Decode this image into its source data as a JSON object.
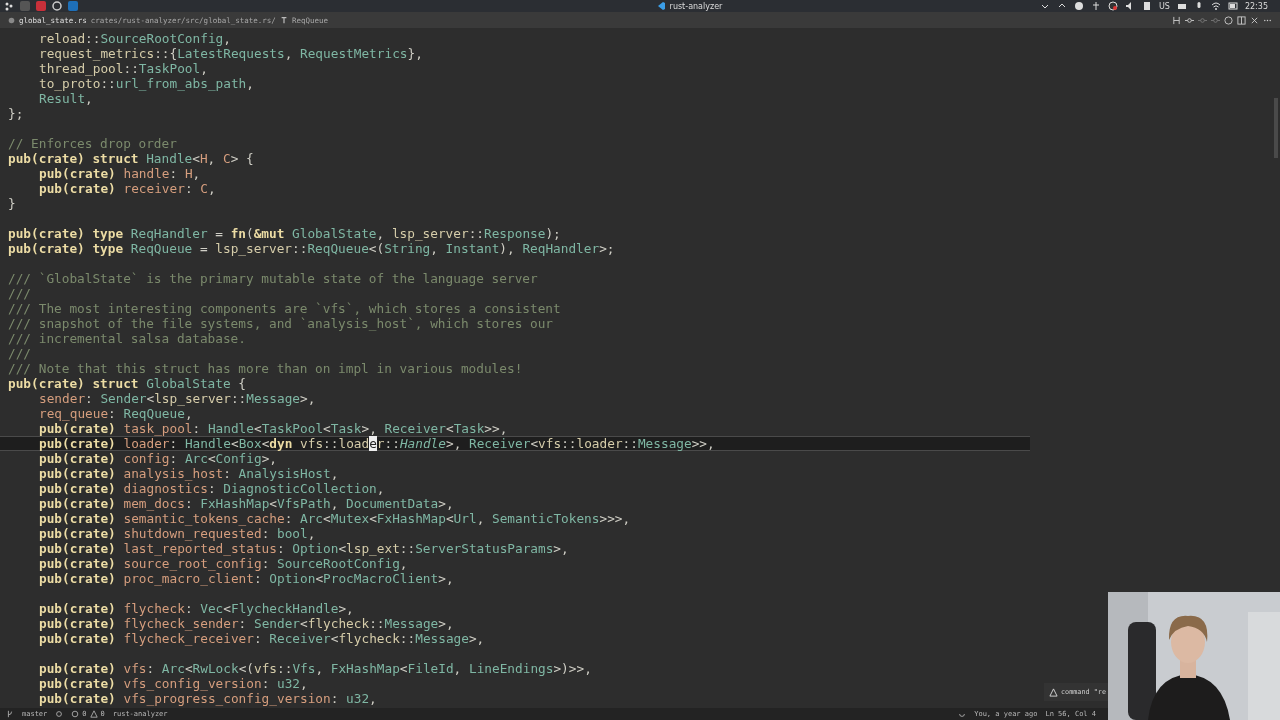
{
  "system_panel": {
    "app_title": "rust-analyzer",
    "keyboard_layout": "US",
    "clock": "22:35"
  },
  "editor_tab": {
    "file_name": "global_state.rs",
    "path": "crates/rust-analyzer/src/global_state.rs/",
    "symbol": "ReqQueue"
  },
  "code_lines": [
    {
      "current": false,
      "indent": true,
      "tokens": [
        {
          "kind": "module",
          "text": "reload"
        },
        {
          "kind": "punct",
          "text": "::"
        },
        {
          "kind": "type",
          "text": "SourceRootConfig"
        },
        {
          "kind": "punct",
          "text": ","
        }
      ]
    },
    {
      "current": false,
      "indent": true,
      "tokens": [
        {
          "kind": "module",
          "text": "request_metrics"
        },
        {
          "kind": "punct",
          "text": "::{"
        },
        {
          "kind": "type",
          "text": "LatestRequests"
        },
        {
          "kind": "punct",
          "text": ", "
        },
        {
          "kind": "type",
          "text": "RequestMetrics"
        },
        {
          "kind": "punct",
          "text": "},"
        }
      ]
    },
    {
      "current": false,
      "indent": true,
      "tokens": [
        {
          "kind": "module",
          "text": "thread_pool"
        },
        {
          "kind": "punct",
          "text": "::"
        },
        {
          "kind": "type",
          "text": "TaskPool"
        },
        {
          "kind": "punct",
          "text": ","
        }
      ]
    },
    {
      "current": false,
      "indent": true,
      "tokens": [
        {
          "kind": "module",
          "text": "to_proto"
        },
        {
          "kind": "punct",
          "text": "::"
        },
        {
          "kind": "type",
          "text": "url_from_abs_path"
        },
        {
          "kind": "punct",
          "text": ","
        }
      ]
    },
    {
      "current": false,
      "indent": true,
      "tokens": [
        {
          "kind": "type",
          "text": "Result"
        },
        {
          "kind": "punct",
          "text": ","
        }
      ]
    },
    {
      "current": false,
      "indent": false,
      "tokens": [
        {
          "kind": "punct",
          "text": "};"
        }
      ]
    },
    {
      "current": false
    },
    {
      "current": false,
      "indent": false,
      "tokens": [
        {
          "kind": "comment",
          "text": "// Enforces drop order"
        }
      ]
    },
    {
      "current": false,
      "indent": false,
      "tokens": [
        {
          "kind": "keyword",
          "text": "pub(crate) struct "
        },
        {
          "kind": "type",
          "text": "Handle"
        },
        {
          "kind": "punct",
          "text": "<"
        },
        {
          "kind": "field",
          "text": "H"
        },
        {
          "kind": "punct",
          "text": ", "
        },
        {
          "kind": "field",
          "text": "C"
        },
        {
          "kind": "punct",
          "text": "> {"
        }
      ]
    },
    {
      "current": false,
      "indent": true,
      "tokens": [
        {
          "kind": "keyword",
          "text": "pub(crate) "
        },
        {
          "kind": "field",
          "text": "handle"
        },
        {
          "kind": "punct",
          "text": ": "
        },
        {
          "kind": "field",
          "text": "H"
        },
        {
          "kind": "punct",
          "text": ","
        }
      ]
    },
    {
      "current": false,
      "indent": true,
      "tokens": [
        {
          "kind": "keyword",
          "text": "pub(crate) "
        },
        {
          "kind": "field",
          "text": "receiver"
        },
        {
          "kind": "punct",
          "text": ": "
        },
        {
          "kind": "field",
          "text": "C"
        },
        {
          "kind": "punct",
          "text": ","
        }
      ]
    },
    {
      "current": false,
      "indent": false,
      "tokens": [
        {
          "kind": "punct",
          "text": "}"
        }
      ]
    },
    {
      "current": false
    },
    {
      "current": false,
      "indent": false,
      "tokens": [
        {
          "kind": "keyword",
          "text": "pub(crate) type "
        },
        {
          "kind": "type",
          "text": "ReqHandler"
        },
        {
          "kind": "punct",
          "text": " = "
        },
        {
          "kind": "keyword",
          "text": "fn"
        },
        {
          "kind": "punct",
          "text": "("
        },
        {
          "kind": "keyword",
          "text": "&mut "
        },
        {
          "kind": "type",
          "text": "GlobalState"
        },
        {
          "kind": "punct",
          "text": ", "
        },
        {
          "kind": "module",
          "text": "lsp_server"
        },
        {
          "kind": "punct",
          "text": "::"
        },
        {
          "kind": "type",
          "text": "Response"
        },
        {
          "kind": "punct",
          "text": ");"
        }
      ]
    },
    {
      "current": false,
      "indent": false,
      "tokens": [
        {
          "kind": "keyword",
          "text": "pub(crate) type "
        },
        {
          "kind": "type",
          "text": "ReqQueue"
        },
        {
          "kind": "punct",
          "text": " = "
        },
        {
          "kind": "module",
          "text": "lsp_server"
        },
        {
          "kind": "punct",
          "text": "::"
        },
        {
          "kind": "type",
          "text": "ReqQueue"
        },
        {
          "kind": "punct",
          "text": "<("
        },
        {
          "kind": "type",
          "text": "String"
        },
        {
          "kind": "punct",
          "text": ", "
        },
        {
          "kind": "type",
          "text": "Instant"
        },
        {
          "kind": "punct",
          "text": "), "
        },
        {
          "kind": "type",
          "text": "ReqHandler"
        },
        {
          "kind": "punct",
          "text": ">;"
        }
      ]
    },
    {
      "current": false
    },
    {
      "current": false,
      "indent": false,
      "tokens": [
        {
          "kind": "comment",
          "text": "/// `GlobalState` is the primary mutable state of the language server"
        }
      ]
    },
    {
      "current": false,
      "indent": false,
      "tokens": [
        {
          "kind": "comment",
          "text": "///"
        }
      ]
    },
    {
      "current": false,
      "indent": false,
      "tokens": [
        {
          "kind": "comment",
          "text": "/// The most interesting components are `vfs`, which stores a consistent"
        }
      ]
    },
    {
      "current": false,
      "indent": false,
      "tokens": [
        {
          "kind": "comment",
          "text": "/// snapshot of the file systems, and `analysis_host`, which stores our"
        }
      ]
    },
    {
      "current": false,
      "indent": false,
      "tokens": [
        {
          "kind": "comment",
          "text": "/// incremental salsa database."
        }
      ]
    },
    {
      "current": false,
      "indent": false,
      "tokens": [
        {
          "kind": "comment",
          "text": "///"
        }
      ]
    },
    {
      "current": false,
      "indent": false,
      "tokens": [
        {
          "kind": "comment",
          "text": "/// Note that this struct has more than on impl in various modules!"
        }
      ]
    },
    {
      "current": false,
      "indent": false,
      "tokens": [
        {
          "kind": "keyword",
          "text": "pub(crate) struct "
        },
        {
          "kind": "type",
          "text": "GlobalState"
        },
        {
          "kind": "punct",
          "text": " {"
        }
      ]
    },
    {
      "current": false,
      "indent": true,
      "tokens": [
        {
          "kind": "field",
          "text": "sender"
        },
        {
          "kind": "punct",
          "text": ": "
        },
        {
          "kind": "type",
          "text": "Sender"
        },
        {
          "kind": "punct",
          "text": "<"
        },
        {
          "kind": "module",
          "text": "lsp_server"
        },
        {
          "kind": "punct",
          "text": "::"
        },
        {
          "kind": "type",
          "text": "Message"
        },
        {
          "kind": "punct",
          "text": ">,"
        }
      ]
    },
    {
      "current": false,
      "indent": true,
      "tokens": [
        {
          "kind": "field",
          "text": "req_queue"
        },
        {
          "kind": "punct",
          "text": ": "
        },
        {
          "kind": "type",
          "text": "ReqQueue"
        },
        {
          "kind": "punct",
          "text": ","
        }
      ]
    },
    {
      "current": false,
      "indent": true,
      "tokens": [
        {
          "kind": "keyword",
          "text": "pub(crate) "
        },
        {
          "kind": "field",
          "text": "task_pool"
        },
        {
          "kind": "punct",
          "text": ": "
        },
        {
          "kind": "type",
          "text": "Handle"
        },
        {
          "kind": "punct",
          "text": "<"
        },
        {
          "kind": "type",
          "text": "TaskPool"
        },
        {
          "kind": "punct",
          "text": "<"
        },
        {
          "kind": "type",
          "text": "Task"
        },
        {
          "kind": "punct",
          "text": ">, "
        },
        {
          "kind": "type",
          "text": "Receiver"
        },
        {
          "kind": "punct",
          "text": "<"
        },
        {
          "kind": "type",
          "text": "Task"
        },
        {
          "kind": "punct",
          "text": ">>,"
        }
      ]
    },
    {
      "current": true,
      "indent": true,
      "tokens": [
        {
          "kind": "keyword",
          "text": "pub(crate) "
        },
        {
          "kind": "field",
          "text": "loader"
        },
        {
          "kind": "punct",
          "text": ": "
        },
        {
          "kind": "type",
          "text": "Handle"
        },
        {
          "kind": "punct",
          "text": "<"
        },
        {
          "kind": "type",
          "text": "Box"
        },
        {
          "kind": "punct",
          "text": "<"
        },
        {
          "kind": "keyword",
          "text": "dyn "
        },
        {
          "kind": "module",
          "text": "vfs"
        },
        {
          "kind": "punct",
          "text": "::"
        },
        {
          "kind": "module",
          "text": "load"
        },
        {
          "kind": "cursor",
          "text": "e"
        },
        {
          "kind": "module",
          "text": "r"
        },
        {
          "kind": "punct",
          "text": "::"
        },
        {
          "kind": "trait",
          "text": "Handle"
        },
        {
          "kind": "punct",
          "text": ">, "
        },
        {
          "kind": "type",
          "text": "Receiver"
        },
        {
          "kind": "punct",
          "text": "<"
        },
        {
          "kind": "module",
          "text": "vfs"
        },
        {
          "kind": "punct",
          "text": "::"
        },
        {
          "kind": "module",
          "text": "loader"
        },
        {
          "kind": "punct",
          "text": "::"
        },
        {
          "kind": "type",
          "text": "Message"
        },
        {
          "kind": "punct",
          "text": ">>,"
        }
      ]
    },
    {
      "current": false,
      "indent": true,
      "tokens": [
        {
          "kind": "keyword",
          "text": "pub(crate) "
        },
        {
          "kind": "field",
          "text": "config"
        },
        {
          "kind": "punct",
          "text": ": "
        },
        {
          "kind": "type",
          "text": "Arc"
        },
        {
          "kind": "punct",
          "text": "<"
        },
        {
          "kind": "type",
          "text": "Config"
        },
        {
          "kind": "punct",
          "text": ">,"
        }
      ]
    },
    {
      "current": false,
      "indent": true,
      "tokens": [
        {
          "kind": "keyword",
          "text": "pub(crate) "
        },
        {
          "kind": "field",
          "text": "analysis_host"
        },
        {
          "kind": "punct",
          "text": ": "
        },
        {
          "kind": "type",
          "text": "AnalysisHost"
        },
        {
          "kind": "punct",
          "text": ","
        }
      ]
    },
    {
      "current": false,
      "indent": true,
      "tokens": [
        {
          "kind": "keyword",
          "text": "pub(crate) "
        },
        {
          "kind": "field",
          "text": "diagnostics"
        },
        {
          "kind": "punct",
          "text": ": "
        },
        {
          "kind": "type",
          "text": "DiagnosticCollection"
        },
        {
          "kind": "punct",
          "text": ","
        }
      ]
    },
    {
      "current": false,
      "indent": true,
      "tokens": [
        {
          "kind": "keyword",
          "text": "pub(crate) "
        },
        {
          "kind": "field",
          "text": "mem_docs"
        },
        {
          "kind": "punct",
          "text": ": "
        },
        {
          "kind": "type",
          "text": "FxHashMap"
        },
        {
          "kind": "punct",
          "text": "<"
        },
        {
          "kind": "type",
          "text": "VfsPath"
        },
        {
          "kind": "punct",
          "text": ", "
        },
        {
          "kind": "type",
          "text": "DocumentData"
        },
        {
          "kind": "punct",
          "text": ">,"
        }
      ]
    },
    {
      "current": false,
      "indent": true,
      "tokens": [
        {
          "kind": "keyword",
          "text": "pub(crate) "
        },
        {
          "kind": "field",
          "text": "semantic_tokens_cache"
        },
        {
          "kind": "punct",
          "text": ": "
        },
        {
          "kind": "type",
          "text": "Arc"
        },
        {
          "kind": "punct",
          "text": "<"
        },
        {
          "kind": "type",
          "text": "Mutex"
        },
        {
          "kind": "punct",
          "text": "<"
        },
        {
          "kind": "type",
          "text": "FxHashMap"
        },
        {
          "kind": "punct",
          "text": "<"
        },
        {
          "kind": "type",
          "text": "Url"
        },
        {
          "kind": "punct",
          "text": ", "
        },
        {
          "kind": "type",
          "text": "SemanticTokens"
        },
        {
          "kind": "punct",
          "text": ">>>,"
        }
      ]
    },
    {
      "current": false,
      "indent": true,
      "tokens": [
        {
          "kind": "keyword",
          "text": "pub(crate) "
        },
        {
          "kind": "field",
          "text": "shutdown_requested"
        },
        {
          "kind": "punct",
          "text": ": "
        },
        {
          "kind": "type",
          "text": "bool"
        },
        {
          "kind": "punct",
          "text": ","
        }
      ]
    },
    {
      "current": false,
      "indent": true,
      "tokens": [
        {
          "kind": "keyword",
          "text": "pub(crate) "
        },
        {
          "kind": "field",
          "text": "last_reported_status"
        },
        {
          "kind": "punct",
          "text": ": "
        },
        {
          "kind": "type",
          "text": "Option"
        },
        {
          "kind": "punct",
          "text": "<"
        },
        {
          "kind": "module",
          "text": "lsp_ext"
        },
        {
          "kind": "punct",
          "text": "::"
        },
        {
          "kind": "type",
          "text": "ServerStatusParams"
        },
        {
          "kind": "punct",
          "text": ">,"
        }
      ]
    },
    {
      "current": false,
      "indent": true,
      "tokens": [
        {
          "kind": "keyword",
          "text": "pub(crate) "
        },
        {
          "kind": "field",
          "text": "source_root_config"
        },
        {
          "kind": "punct",
          "text": ": "
        },
        {
          "kind": "type",
          "text": "SourceRootConfig"
        },
        {
          "kind": "punct",
          "text": ","
        }
      ]
    },
    {
      "current": false,
      "indent": true,
      "tokens": [
        {
          "kind": "keyword",
          "text": "pub(crate) "
        },
        {
          "kind": "field",
          "text": "proc_macro_client"
        },
        {
          "kind": "punct",
          "text": ": "
        },
        {
          "kind": "type",
          "text": "Option"
        },
        {
          "kind": "punct",
          "text": "<"
        },
        {
          "kind": "type",
          "text": "ProcMacroClient"
        },
        {
          "kind": "punct",
          "text": ">,"
        }
      ]
    },
    {
      "current": false
    },
    {
      "current": false,
      "indent": true,
      "tokens": [
        {
          "kind": "keyword",
          "text": "pub(crate) "
        },
        {
          "kind": "field",
          "text": "flycheck"
        },
        {
          "kind": "punct",
          "text": ": "
        },
        {
          "kind": "type",
          "text": "Vec"
        },
        {
          "kind": "punct",
          "text": "<"
        },
        {
          "kind": "type",
          "text": "FlycheckHandle"
        },
        {
          "kind": "punct",
          "text": ">,"
        }
      ]
    },
    {
      "current": false,
      "indent": true,
      "tokens": [
        {
          "kind": "keyword",
          "text": "pub(crate) "
        },
        {
          "kind": "field",
          "text": "flycheck_sender"
        },
        {
          "kind": "punct",
          "text": ": "
        },
        {
          "kind": "type",
          "text": "Sender"
        },
        {
          "kind": "punct",
          "text": "<"
        },
        {
          "kind": "module",
          "text": "flycheck"
        },
        {
          "kind": "punct",
          "text": "::"
        },
        {
          "kind": "type",
          "text": "Message"
        },
        {
          "kind": "punct",
          "text": ">,"
        }
      ]
    },
    {
      "current": false,
      "indent": true,
      "tokens": [
        {
          "kind": "keyword",
          "text": "pub(crate) "
        },
        {
          "kind": "field",
          "text": "flycheck_receiver"
        },
        {
          "kind": "punct",
          "text": ": "
        },
        {
          "kind": "type",
          "text": "Receiver"
        },
        {
          "kind": "punct",
          "text": "<"
        },
        {
          "kind": "module",
          "text": "flycheck"
        },
        {
          "kind": "punct",
          "text": "::"
        },
        {
          "kind": "type",
          "text": "Message"
        },
        {
          "kind": "punct",
          "text": ">,"
        }
      ]
    },
    {
      "current": false
    },
    {
      "current": false,
      "indent": true,
      "tokens": [
        {
          "kind": "keyword",
          "text": "pub(crate) "
        },
        {
          "kind": "field",
          "text": "vfs"
        },
        {
          "kind": "punct",
          "text": ": "
        },
        {
          "kind": "type",
          "text": "Arc"
        },
        {
          "kind": "punct",
          "text": "<"
        },
        {
          "kind": "type",
          "text": "RwLock"
        },
        {
          "kind": "punct",
          "text": "<("
        },
        {
          "kind": "module",
          "text": "vfs"
        },
        {
          "kind": "punct",
          "text": "::"
        },
        {
          "kind": "type",
          "text": "Vfs"
        },
        {
          "kind": "punct",
          "text": ", "
        },
        {
          "kind": "type",
          "text": "FxHashMap"
        },
        {
          "kind": "punct",
          "text": "<"
        },
        {
          "kind": "type",
          "text": "FileId"
        },
        {
          "kind": "punct",
          "text": ", "
        },
        {
          "kind": "type",
          "text": "LineEndings"
        },
        {
          "kind": "punct",
          "text": ">)>>,"
        }
      ]
    },
    {
      "current": false,
      "indent": true,
      "tokens": [
        {
          "kind": "keyword",
          "text": "pub(crate) "
        },
        {
          "kind": "field",
          "text": "vfs_config_version"
        },
        {
          "kind": "punct",
          "text": ": "
        },
        {
          "kind": "type",
          "text": "u32"
        },
        {
          "kind": "punct",
          "text": ","
        }
      ]
    },
    {
      "current": false,
      "indent": true,
      "tokens": [
        {
          "kind": "keyword",
          "text": "pub(crate) "
        },
        {
          "kind": "field",
          "text": "vfs_progress_config_version"
        },
        {
          "kind": "punct",
          "text": ": "
        },
        {
          "kind": "type",
          "text": "u32"
        },
        {
          "kind": "punct",
          "text": ","
        }
      ]
    }
  ],
  "notification": {
    "text": "command \"re"
  },
  "status_bar": {
    "branch": "master",
    "errors": "0",
    "warnings": "0",
    "extension": "rust-analyzer",
    "blame": "You, a year ago",
    "position": "Ln 56, Col 4"
  }
}
